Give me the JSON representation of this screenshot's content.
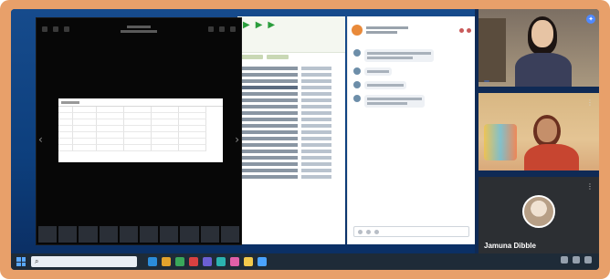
{
  "colors": {
    "frame": "#e8a06a",
    "accent": "#2a9d3c"
  },
  "viewer": {
    "table_headers": [
      "",
      "",
      "",
      "",
      "",
      ""
    ],
    "rows": [
      [
        "",
        "",
        "",
        "",
        "",
        ""
      ],
      [
        "",
        "",
        "",
        "",
        "",
        ""
      ],
      [
        "",
        "",
        "",
        "",
        "",
        ""
      ],
      [
        "",
        "",
        "",
        "",
        "",
        ""
      ],
      [
        "",
        "",
        "",
        "",
        "",
        ""
      ],
      [
        "",
        "",
        "",
        "",
        "",
        ""
      ]
    ]
  },
  "taskbar": {
    "search_icon": "search-icon",
    "search_placeholder": "",
    "apps": [
      "#2b8cd9",
      "#e2a22c",
      "#39a85a",
      "#d94141",
      "#6b5fd4",
      "#2bb3b0",
      "#e15fa8",
      "#f2c94c",
      "#4aa3ff"
    ]
  },
  "participants": [
    {
      "name": "",
      "pin_icon": "pin-icon"
    },
    {
      "name": "",
      "more_icon": "more-icon"
    },
    {
      "name": "Jamuna Dibble",
      "more_icon": "more-icon"
    }
  ]
}
